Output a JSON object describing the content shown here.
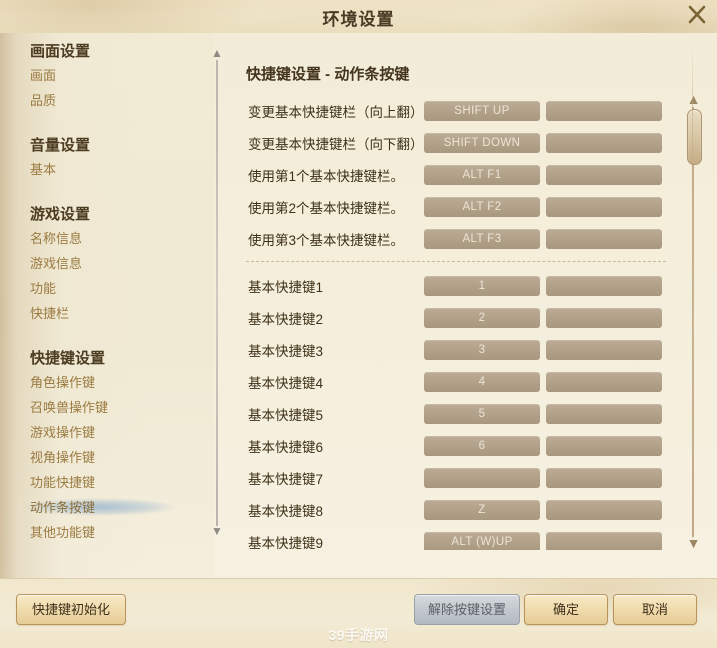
{
  "window": {
    "title": "环境设置",
    "close_icon": "close-icon"
  },
  "sidebar": {
    "groups": [
      {
        "title": "画面设置",
        "items": [
          {
            "label": "画面",
            "selected": false
          },
          {
            "label": "品质",
            "selected": false
          }
        ]
      },
      {
        "title": "音量设置",
        "items": [
          {
            "label": "基本",
            "selected": false
          }
        ]
      },
      {
        "title": "游戏设置",
        "items": [
          {
            "label": "名称信息",
            "selected": false
          },
          {
            "label": "游戏信息",
            "selected": false
          },
          {
            "label": "功能",
            "selected": false
          },
          {
            "label": "快捷栏",
            "selected": false
          }
        ]
      },
      {
        "title": "快捷键设置",
        "items": [
          {
            "label": "角色操作键",
            "selected": false
          },
          {
            "label": "召唤兽操作键",
            "selected": false
          },
          {
            "label": "游戏操作键",
            "selected": false
          },
          {
            "label": "视角操作键",
            "selected": false
          },
          {
            "label": "功能快捷键",
            "selected": false
          },
          {
            "label": "动作条按键",
            "selected": true
          },
          {
            "label": "其他功能键",
            "selected": false
          }
        ]
      }
    ],
    "scrollbar": {
      "up_arrow": "▲",
      "down_arrow": "▼"
    }
  },
  "content": {
    "title": "快捷键设置 - 动作条按键",
    "sections": [
      {
        "rows": [
          {
            "label": "变更基本快捷键栏（向上翻）",
            "key1": "SHIFT UP",
            "key2": ""
          },
          {
            "label": "变更基本快捷键栏（向下翻）",
            "key1": "SHIFT DOWN",
            "key2": ""
          },
          {
            "label": "使用第1个基本快捷键栏。",
            "key1": "ALT F1",
            "key2": ""
          },
          {
            "label": "使用第2个基本快捷键栏。",
            "key1": "ALT F2",
            "key2": ""
          },
          {
            "label": "使用第3个基本快捷键栏。",
            "key1": "ALT F3",
            "key2": ""
          }
        ]
      },
      {
        "rows": [
          {
            "label": "基本快捷键1",
            "key1": "1",
            "key2": ""
          },
          {
            "label": "基本快捷键2",
            "key1": "2",
            "key2": ""
          },
          {
            "label": "基本快捷键3",
            "key1": "3",
            "key2": ""
          },
          {
            "label": "基本快捷键4",
            "key1": "4",
            "key2": ""
          },
          {
            "label": "基本快捷键5",
            "key1": "5",
            "key2": ""
          },
          {
            "label": "基本快捷键6",
            "key1": "6",
            "key2": ""
          },
          {
            "label": "基本快捷键7",
            "key1": "",
            "key2": ""
          },
          {
            "label": "基本快捷键8",
            "key1": "Z",
            "key2": ""
          },
          {
            "label": "基本快捷键9",
            "key1": "ALT (W)UP",
            "key2": ""
          }
        ]
      }
    ],
    "scrollbar": {
      "up_arrow": "▲",
      "down_arrow": "▼"
    }
  },
  "footer": {
    "init_label": "快捷键初始化",
    "clear_label": "解除按键设置",
    "ok_label": "确定",
    "cancel_label": "取消",
    "watermark": "39手游网"
  },
  "colors": {
    "page_bg": "#f3ead3",
    "title_text": "#4a3a24",
    "sidebar_head": "#4c3c22",
    "sidebar_item": "#9a7b42",
    "selection_highlight": "#7ea6cd",
    "key_button": "#b2a086",
    "key_button_text": "#ece4d6",
    "gold_button": "#f0dcae",
    "grey_button": "#c4c9cf"
  }
}
